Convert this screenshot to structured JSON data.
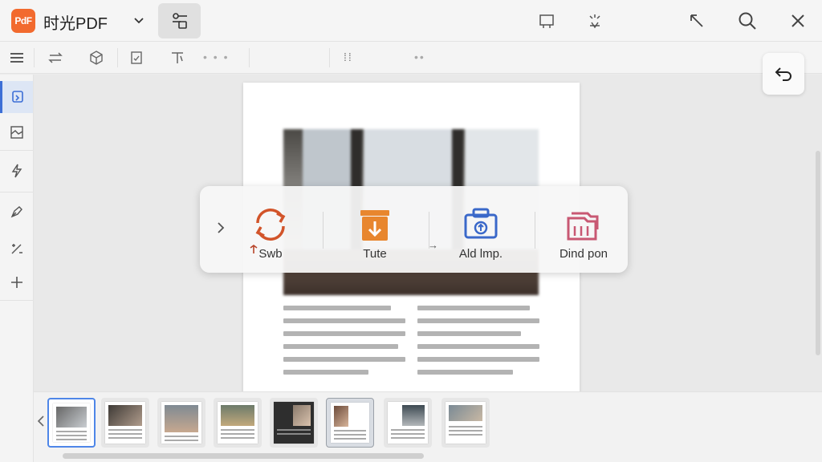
{
  "app": {
    "title": "时光PDF",
    "logo_text": "PdF"
  },
  "action_panel": {
    "actions": [
      {
        "label": "Swb",
        "icon": "refresh-icon",
        "color": "#d2542a"
      },
      {
        "label": "Tute",
        "icon": "export-down-icon",
        "color": "#e8862e"
      },
      {
        "label": "Ald lmp.",
        "icon": "upload-briefcase-icon",
        "color": "#3a68c9"
      },
      {
        "label": "Dind pon",
        "icon": "folder-stack-icon",
        "color": "#c85873"
      }
    ]
  },
  "thumbnails": {
    "count": 8,
    "selected_index": 0,
    "current_index": 5
  },
  "colors": {
    "accent": "#3d6fd6",
    "brand": "#f26a2e"
  }
}
